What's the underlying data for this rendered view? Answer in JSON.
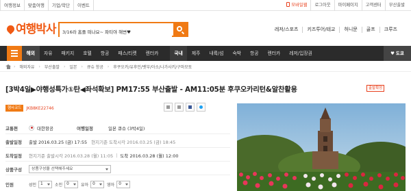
{
  "topbar": {
    "left": [
      "여행정보",
      "맞춤여행",
      "기업/학단",
      "이벤트"
    ],
    "right": [
      "모바일웹",
      "로그아웃",
      "마이페이지",
      "고객센터",
      "부산출발"
    ]
  },
  "header": {
    "logo": "여행박사",
    "search_value": "3/16라 홈플 떠나요~ 파티야 해변♥",
    "categories": [
      "레저/스포츠",
      "키즈투어/테교",
      "허니문",
      "골프",
      "크루즈"
    ]
  },
  "nav": {
    "items": [
      "해외",
      "자유",
      "패키지",
      "호텔",
      "항공",
      "패스/티켓",
      "렌터카",
      "국내",
      "제주",
      "내륙/섬",
      "숙박",
      "항공",
      "렌터카",
      "레저/입장권"
    ],
    "right": "도쿄"
  },
  "breadcrumb": [
    "해외자유",
    "부산출발",
    "일본",
    "큐슈 항공",
    "후쿠오카/유후인/벳부/아소/나가사키/구마모토"
  ],
  "product": {
    "title": "[3박4일▶야행성특가①탄◀좌석확보]  PM17:55 부산출발 - AM11:05분 후쿠오카리턴&알찬활용",
    "verified": "출발확정",
    "code_label": "행사코드",
    "code": "JKB8KE22746",
    "rows": {
      "transport_label": "교통편",
      "airline": "대한항공",
      "itinerary_label": "여행일정",
      "itinerary": "일본 큐슈 (3박4일)",
      "depart_label": "출발일정",
      "depart": "출발 2016.03.25 (금) 17:55",
      "depart_local": "현지기준 도착시각 2016.03.25 (금) 18:45",
      "arrive_label": "도착일정",
      "arrive_local": "현지기준 출발시각 2016.03.28 (월) 11:05",
      "arrive": "도착 2016.03.28 (월) 12:00",
      "option_label": "상품구성",
      "option_placeholder": "상품구성을 선택해주세요",
      "people_label": "인원",
      "adult": "성인",
      "adult_val": "1",
      "child": "소인",
      "child_val": "0",
      "infant": "유아",
      "infant_val": "0",
      "baby": "영아",
      "baby_val": "0"
    }
  },
  "colors": {
    "brand": "#f07a14",
    "nav_bg": "#2b2b2b",
    "accent_red": "#e8401c"
  }
}
